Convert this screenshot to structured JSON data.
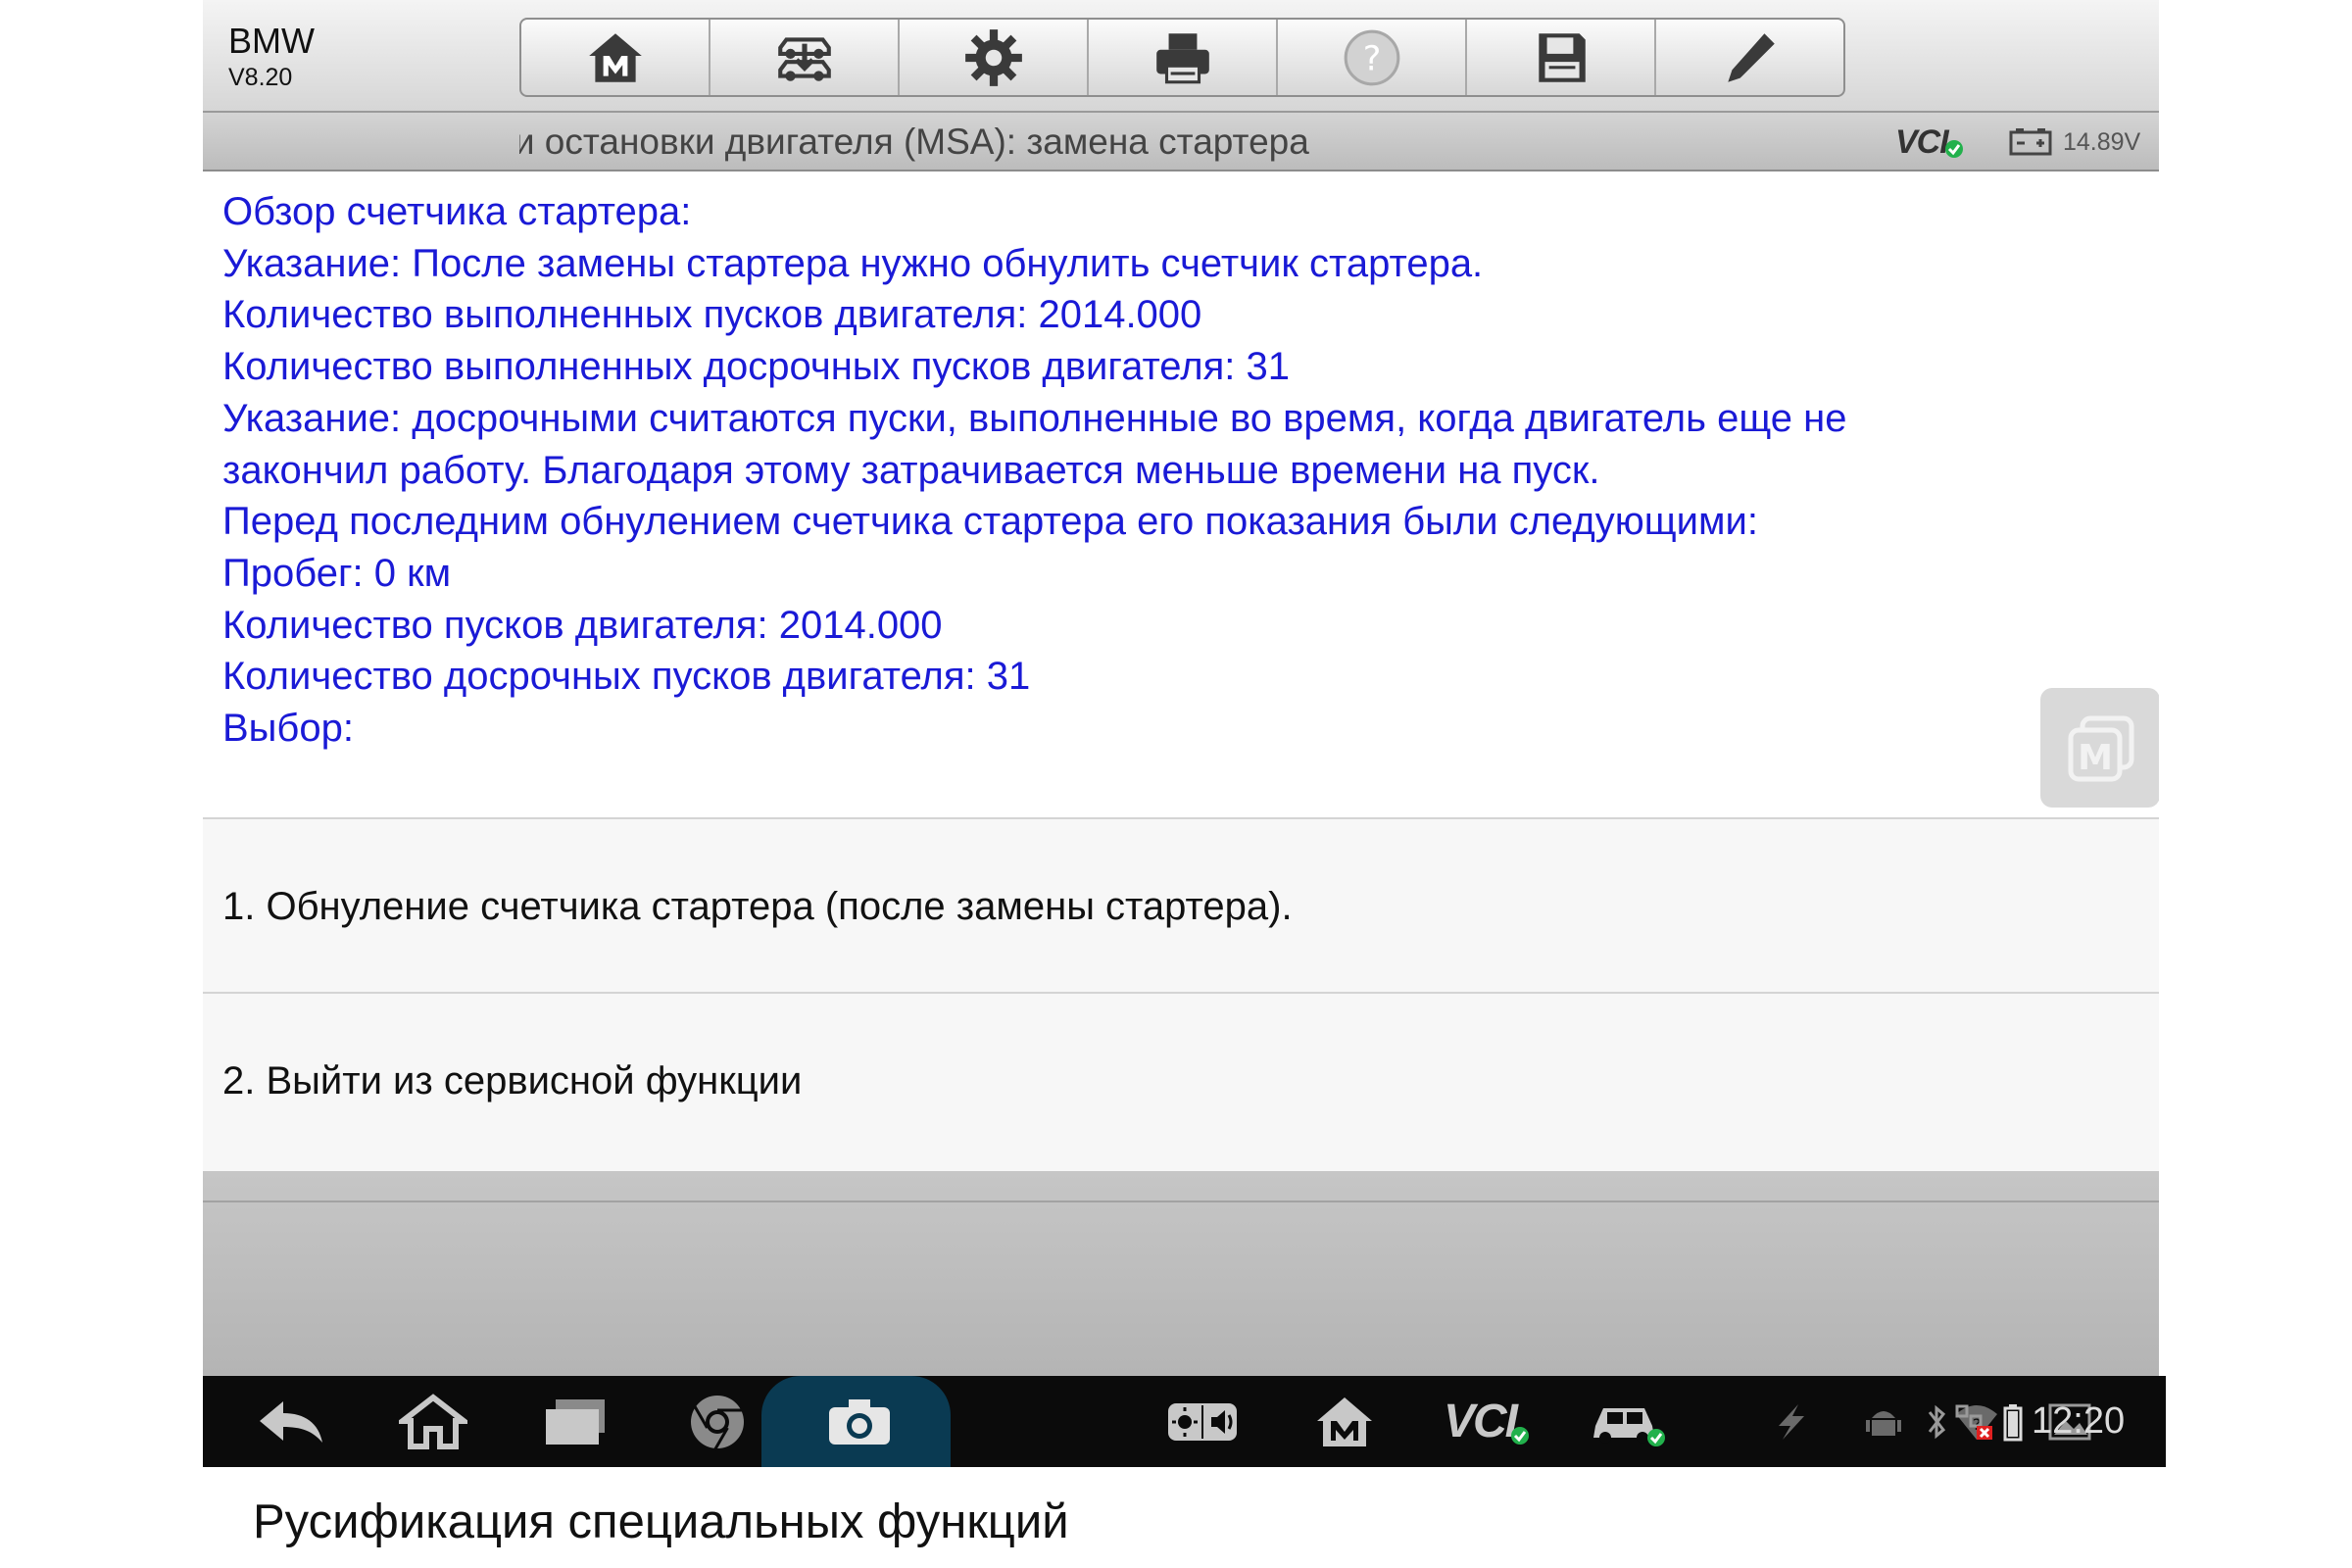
{
  "header": {
    "brand": "BMW",
    "version": "V8.20",
    "toolbar": [
      {
        "name": "home-m-button",
        "icon": "home-m-icon"
      },
      {
        "name": "vehicle-swap-button",
        "icon": "car-swap-icon"
      },
      {
        "name": "settings-button",
        "icon": "gear-icon"
      },
      {
        "name": "print-button",
        "icon": "printer-icon"
      },
      {
        "name": "help-button",
        "icon": "help-icon"
      },
      {
        "name": "save-button",
        "icon": "floppy-icon"
      },
      {
        "name": "edit-button",
        "icon": "pencil-icon"
      }
    ]
  },
  "titlebar": {
    "title": "а и остановки двигателя (MSA): замена стартера",
    "vci_label": "VCI",
    "voltage": "14.89V"
  },
  "content": {
    "lines": [
      "Обзор счетчика стартера:",
      "Указание: После замены стартера нужно обнулить счетчик стартера.",
      "Количество выполненных пусков двигателя: 2014.000",
      "Количество выполненных досрочных пусков двигателя: 31",
      "Указание: досрочными считаются пуски, выполненные во время, когда двигатель еще не",
      "закончил работу. Благодаря этому затрачивается меньше времени на пуск.",
      "Перед последним обнулением счетчика стартера его показания были следующими:",
      "Пробег: 0 км",
      "Количество пусков двигателя: 2014.000",
      "Количество досрочных пусков двигателя: 31",
      "Выбор:"
    ]
  },
  "options": [
    "1. Обнуление счетчика стартера (после замены стартера).",
    "2. Выйти из сервисной функции"
  ],
  "navbar": {
    "vci_label": "VCI",
    "clock": "12:20"
  },
  "caption": "Русификация специальных функций",
  "colors": {
    "content_text": "#1a1ad6",
    "navbar_bg": "#0b0b0b",
    "camera_highlight": "#0a3a52",
    "status_ok": "#22b14c"
  }
}
